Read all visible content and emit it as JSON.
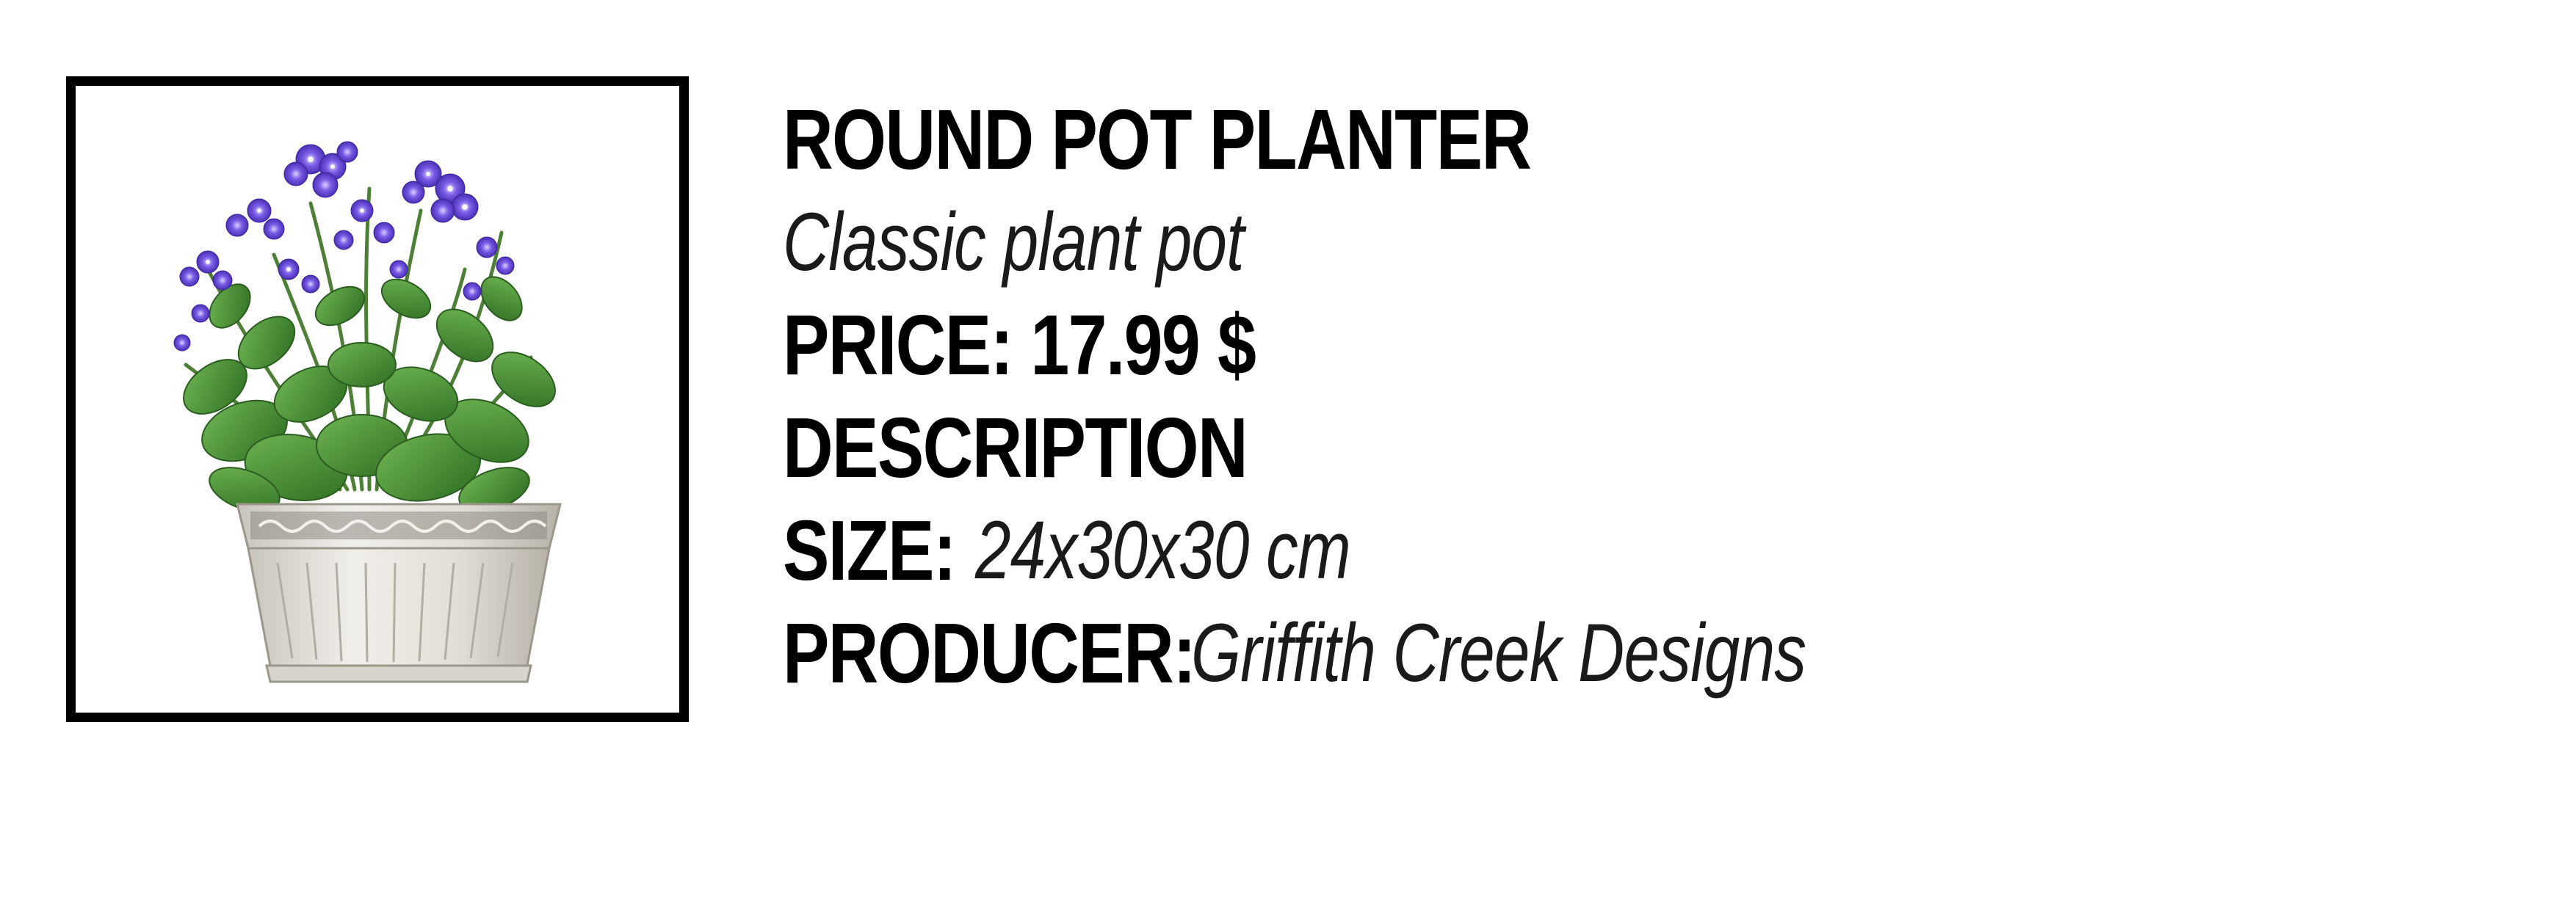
{
  "product": {
    "image_icon": "potted-flower-plant-image",
    "title": "ROUND POT PLANTER",
    "subtitle": "Classic plant pot",
    "price_line": "PRICE: 17.99 $",
    "description_heading": "DESCRIPTION",
    "size_label": "SIZE:",
    "size_value": "24x30x30 cm",
    "producer_label": "PRODUCER:",
    "producer_value": "Griffith Creek Designs"
  },
  "colors": {
    "frame": "#000000",
    "flower": "#6a4fd8",
    "leaf": "#3d8a2e",
    "pot": "#e6e3dc"
  }
}
